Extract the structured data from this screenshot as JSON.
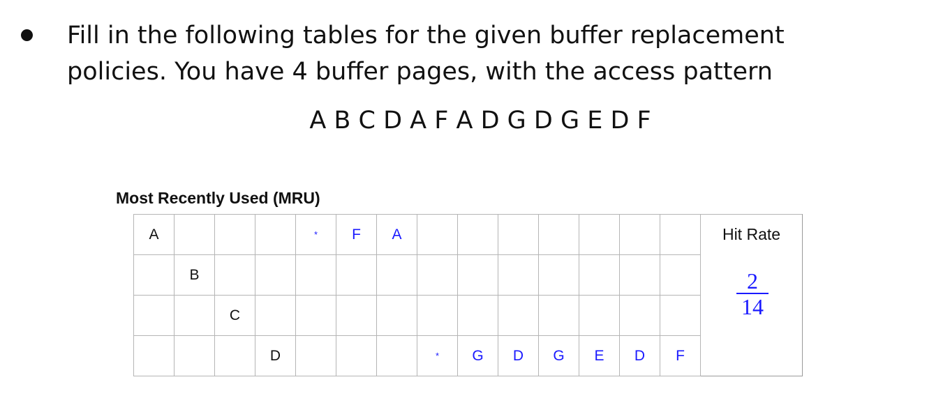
{
  "prompt": {
    "line1": "Fill in the following tables for the given buffer replacement",
    "line2": "policies. You have 4 buffer pages, with the access pattern",
    "access_pattern": "A B C D A F A D G D G E D F"
  },
  "table": {
    "title": "Most Recently Used (MRU)",
    "rows": [
      [
        "A",
        "",
        "",
        "",
        "*",
        "F",
        "A",
        "",
        "",
        "",
        "",
        "",
        "",
        ""
      ],
      [
        "",
        "B",
        "",
        "",
        "",
        "",
        "",
        "",
        "",
        "",
        "",
        "",
        "",
        ""
      ],
      [
        "",
        "",
        "C",
        "",
        "",
        "",
        "",
        "",
        "",
        "",
        "",
        "",
        "",
        ""
      ],
      [
        "",
        "",
        "",
        "D",
        "",
        "",
        "",
        "*",
        "G",
        "D",
        "G",
        "E",
        "D",
        "F"
      ]
    ],
    "blue_cells": [
      [
        0,
        4
      ],
      [
        0,
        5
      ],
      [
        0,
        6
      ],
      [
        3,
        7
      ],
      [
        3,
        8
      ],
      [
        3,
        9
      ],
      [
        3,
        10
      ],
      [
        3,
        11
      ],
      [
        3,
        12
      ],
      [
        3,
        13
      ]
    ],
    "hit_rate_label": "Hit Rate",
    "hit_rate": {
      "numerator": "2",
      "denominator": "14"
    },
    "colors": {
      "annotation": "#1a1aff",
      "text": "#111111",
      "grid": "#b5b5b5"
    }
  }
}
